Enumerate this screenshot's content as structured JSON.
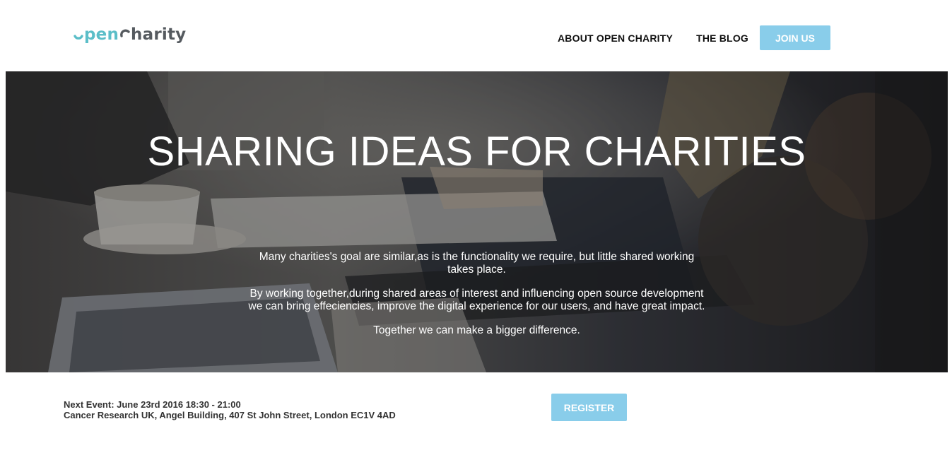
{
  "brand": {
    "logo_text_open": "pen",
    "logo_text_charity": "harity",
    "logo_name": "open-charity-logo"
  },
  "nav": {
    "about_label": "ABOUT OPEN CHARITY",
    "blog_label": "THE BLOG",
    "join_label": "JOIN US"
  },
  "hero": {
    "title": "SHARING IDEAS FOR CHARITIES",
    "paragraphs": [
      "Many charities's goal are similar,as is the functionality we require, but little shared working takes place.",
      "By working together,during shared areas of interest and influencing open source development we can bring effeciencies, improve the digital experience for our users, and have great impact.",
      "Together we can make a bigger difference."
    ]
  },
  "event": {
    "line1": "Next Event: June 23rd 2016 18:30 - 21:00",
    "line2": "Cancer Research UK, Angel Building, 407 St John Street, London EC1V 4AD",
    "register_label": "REGISTER"
  },
  "colors": {
    "accent": "#89cdea",
    "logo_teal": "#5bbec8",
    "logo_gray": "#555a5f"
  }
}
